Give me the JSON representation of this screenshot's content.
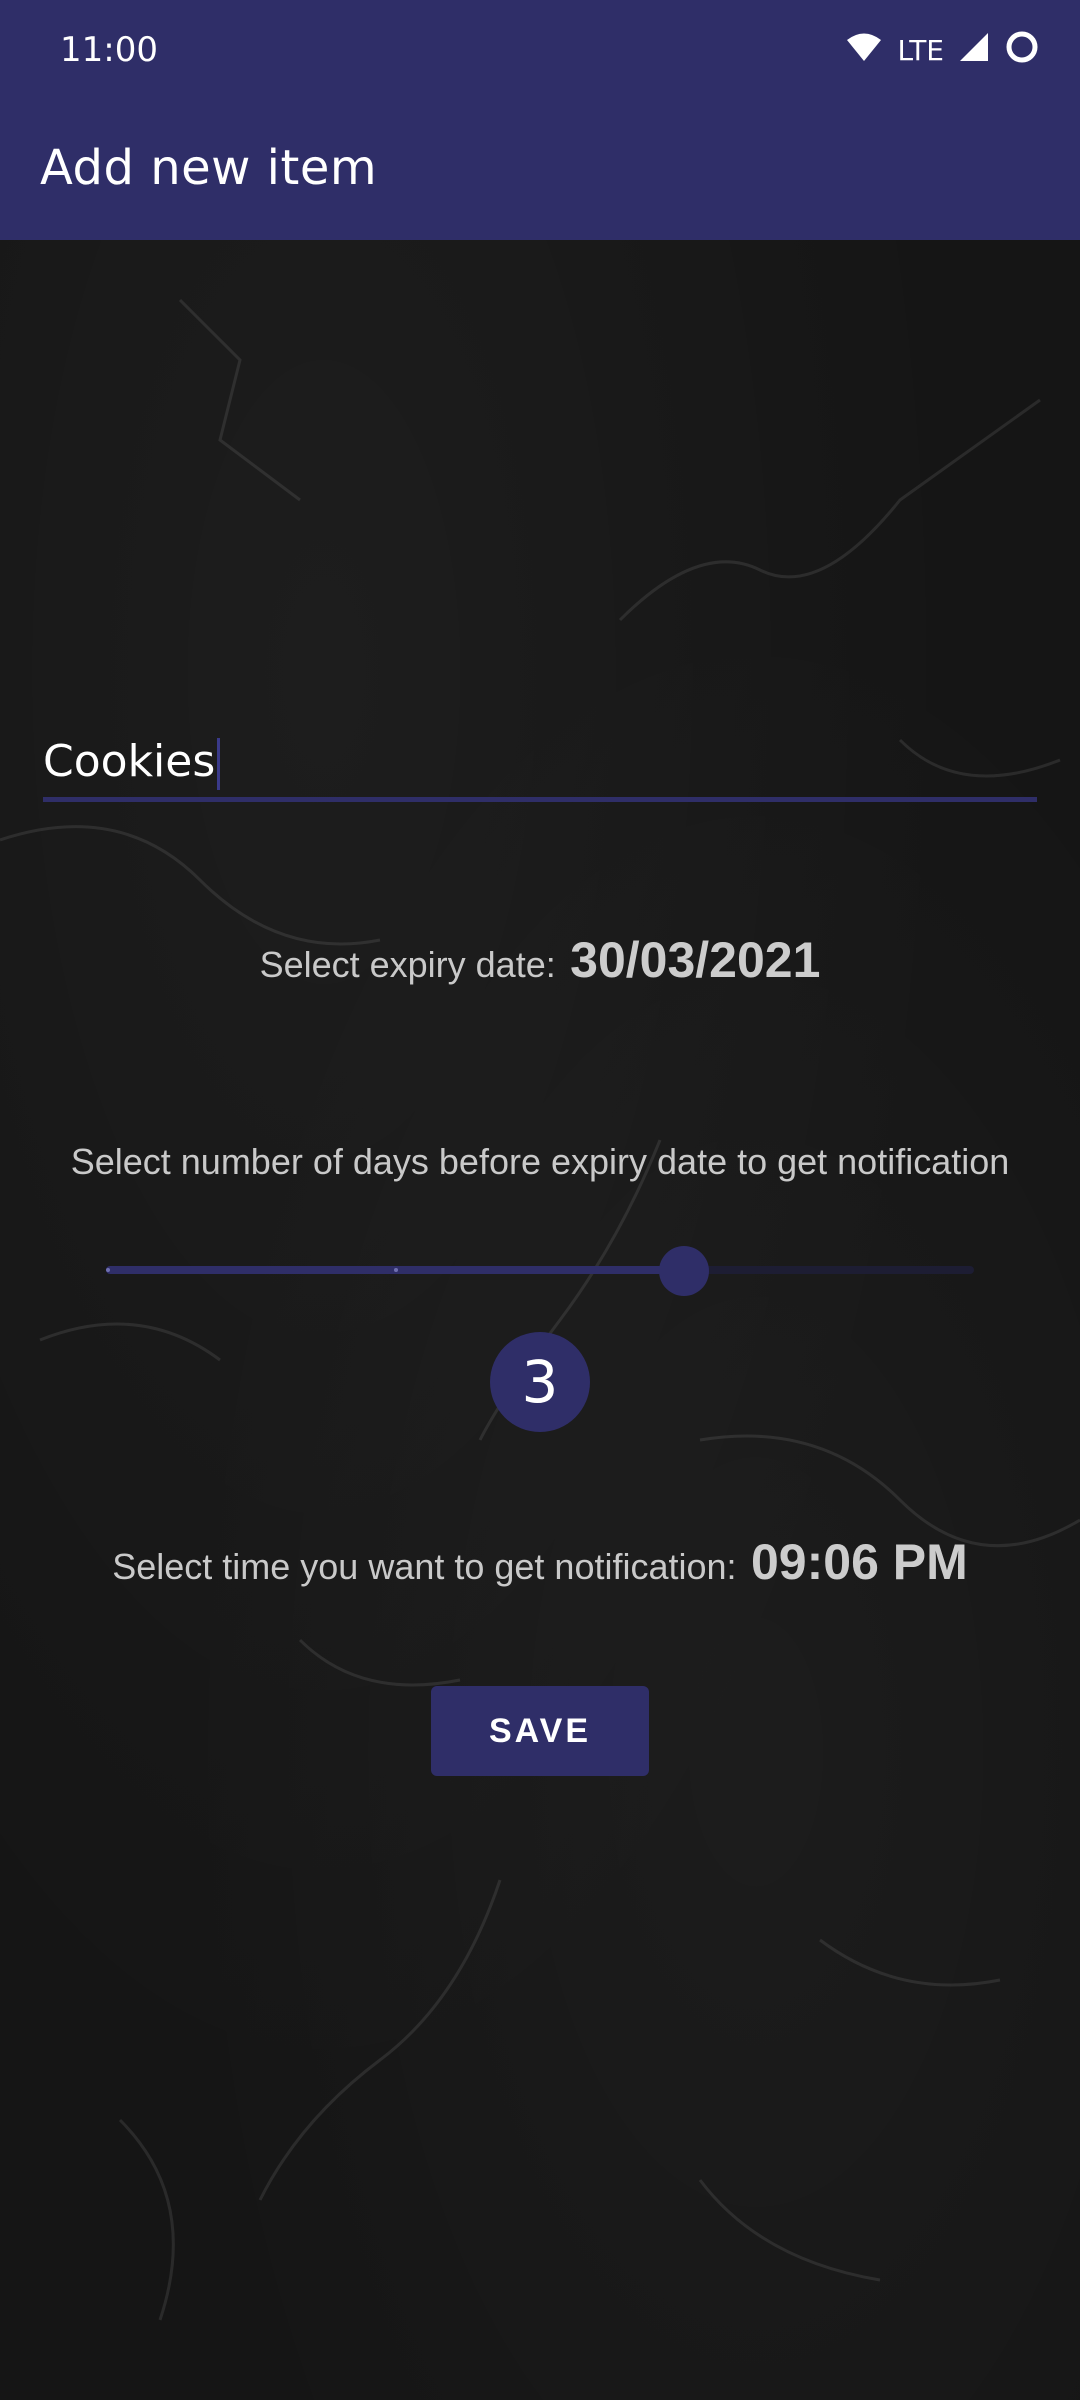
{
  "status_bar": {
    "time": "11:00",
    "network": "LTE",
    "icons": [
      "wifi-icon",
      "cellular-signal-icon",
      "circle-icon"
    ]
  },
  "app_bar": {
    "title": "Add new item"
  },
  "form": {
    "item_name": "Cookies",
    "expiry_label": "Select expiry date:",
    "expiry_value": "30/03/2021",
    "notify_days_label": "Select number of days before expiry date to get notification",
    "notify_days_value": "3",
    "notify_days_fraction": 0.67,
    "time_label": "Select time you want to get notification:",
    "time_value": "09:06 PM",
    "save_label": "SAVE"
  },
  "colors": {
    "primary": "#2f2e68",
    "background": "#151515",
    "text": "#c9c9c9"
  }
}
